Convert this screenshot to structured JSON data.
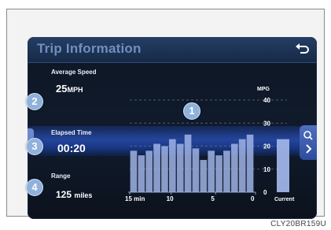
{
  "screen": {
    "title": "Trip Information",
    "back_icon": "back-arrow-icon",
    "average_speed": {
      "label": "Average Speed",
      "value": "25",
      "unit": "MPH"
    },
    "elapsed_time": {
      "label": "Elapsed Time",
      "value": "00:20"
    },
    "range": {
      "label": "Range",
      "value": "125",
      "unit": "miles"
    },
    "zoom_icon": "magnifier-icon",
    "next_icon": "chevron-right-icon"
  },
  "callouts": [
    "1",
    "2",
    "3",
    "4"
  ],
  "caption": "CLY20BR159U",
  "colors": {
    "bar": "#9fb3e6",
    "accent": "#2647a3",
    "title": "#6f8fc0"
  },
  "chart_data": {
    "type": "bar",
    "ylabel": "MPG",
    "ylim": [
      0,
      40
    ],
    "yticks": [
      "0",
      "10",
      "20",
      "30",
      "40"
    ],
    "xticks": [
      "15 min",
      "10",
      "5",
      "0"
    ],
    "current_label": "Current",
    "values": [
      18,
      16,
      18,
      21,
      20,
      23,
      21,
      25,
      19,
      14,
      18,
      16,
      18,
      21,
      23,
      25
    ],
    "current": 23
  }
}
